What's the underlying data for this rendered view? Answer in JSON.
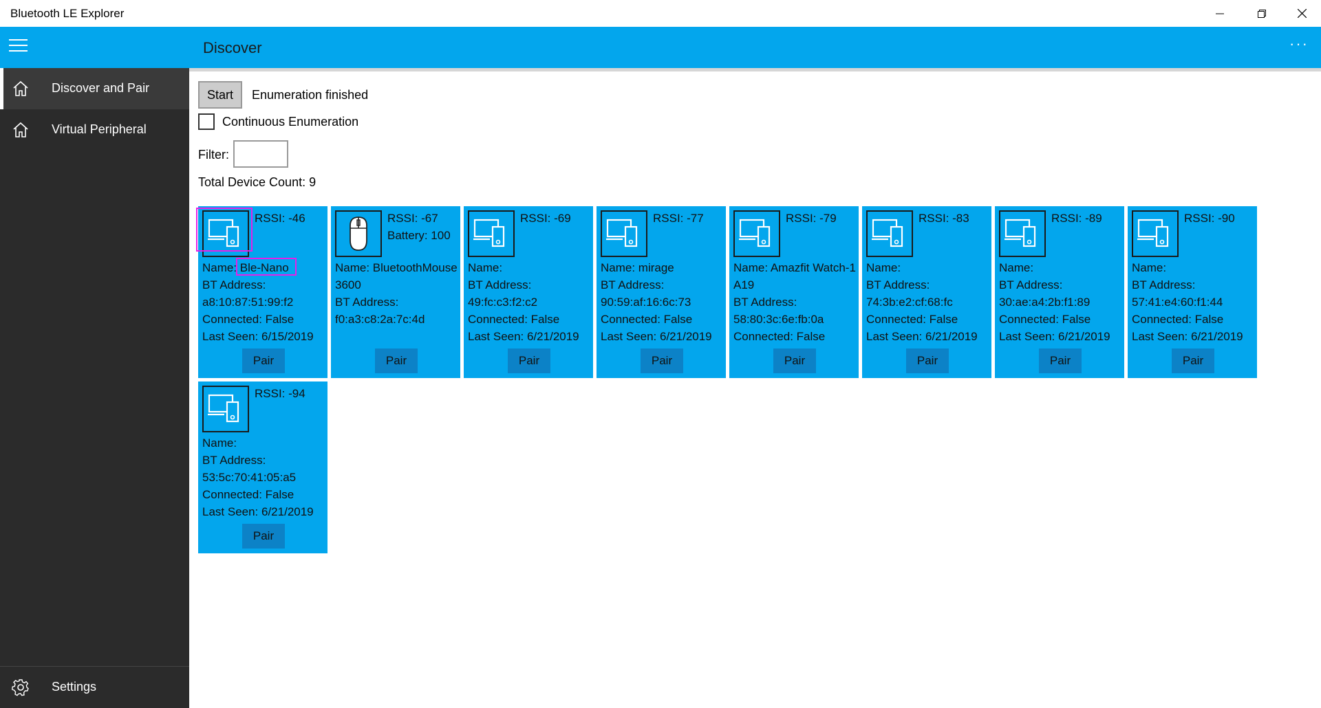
{
  "window": {
    "title": "Bluetooth LE Explorer"
  },
  "header": {
    "page_title": "Discover",
    "more_label": "···"
  },
  "sidebar": {
    "items": [
      {
        "label": "Discover and Pair",
        "icon": "home-icon"
      },
      {
        "label": "Virtual Peripheral",
        "icon": "home-icon"
      }
    ],
    "settings_label": "Settings"
  },
  "controls": {
    "start_label": "Start",
    "status": "Enumeration finished",
    "continuous_label": "Continuous Enumeration",
    "filter_label": "Filter:",
    "filter_value": "",
    "device_count": "Total Device Count: 9"
  },
  "colors": {
    "accent": "#03a6ed",
    "sidebar": "#2b2b2b",
    "pair_button": "#0c82c7",
    "highlight": "#e620e6"
  },
  "devices": [
    {
      "icon": "computer-phone-icon",
      "rssi": "RSSI: -46",
      "battery": "",
      "name": "Name: Ble-Nano",
      "address_label": "BT Address:",
      "address": "a8:10:87:51:99:f2",
      "connected": "Connected: False",
      "last_seen": "Last Seen: 6/15/2019",
      "pair": "Pair"
    },
    {
      "icon": "mouse-icon",
      "rssi": "RSSI: -67",
      "battery": "Battery: 100",
      "name": "Name: BluetoothMouse3600",
      "address_label": "BT Address:",
      "address": "f0:a3:c8:2a:7c:4d",
      "connected": "",
      "last_seen": "",
      "pair": "Pair"
    },
    {
      "icon": "computer-phone-icon",
      "rssi": "RSSI: -69",
      "battery": "",
      "name": "Name:",
      "address_label": "BT Address:",
      "address": "49:fc:c3:f2:c2",
      "connected": "Connected: False",
      "last_seen": "Last Seen: 6/21/2019",
      "pair": "Pair"
    },
    {
      "icon": "computer-phone-icon",
      "rssi": "RSSI: -77",
      "battery": "",
      "name": "Name: mirage",
      "address_label": "BT Address:",
      "address": "90:59:af:16:6c:73",
      "connected": "Connected: False",
      "last_seen": "Last Seen: 6/21/2019",
      "pair": "Pair"
    },
    {
      "icon": "computer-phone-icon",
      "rssi": "RSSI: -79",
      "battery": "",
      "name": "Name: Amazfit Watch-1A19",
      "address_label": "BT Address:",
      "address": "58:80:3c:6e:fb:0a",
      "connected": "Connected: False",
      "last_seen": "",
      "pair": "Pair"
    },
    {
      "icon": "computer-phone-icon",
      "rssi": "RSSI: -83",
      "battery": "",
      "name": "Name:",
      "address_label": "BT Address:",
      "address": "74:3b:e2:cf:68:fc",
      "connected": "Connected: False",
      "last_seen": "Last Seen: 6/21/2019",
      "pair": "Pair"
    },
    {
      "icon": "computer-phone-icon",
      "rssi": "RSSI: -89",
      "battery": "",
      "name": "Name:",
      "address_label": "BT Address:",
      "address": "30:ae:a4:2b:f1:89",
      "connected": "Connected: False",
      "last_seen": "Last Seen: 6/21/2019",
      "pair": "Pair"
    },
    {
      "icon": "computer-phone-icon",
      "rssi": "RSSI: -90",
      "battery": "",
      "name": "Name:",
      "address_label": "BT Address:",
      "address": "57:41:e4:60:f1:44",
      "connected": "Connected: False",
      "last_seen": "Last Seen: 6/21/2019",
      "pair": "Pair"
    },
    {
      "icon": "computer-phone-icon",
      "rssi": "RSSI: -94",
      "battery": "",
      "name": "Name:",
      "address_label": "BT Address:",
      "address": "53:5c:70:41:05:a5",
      "connected": "Connected: False",
      "last_seen": "Last Seen: 6/21/2019",
      "pair": "Pair"
    }
  ]
}
